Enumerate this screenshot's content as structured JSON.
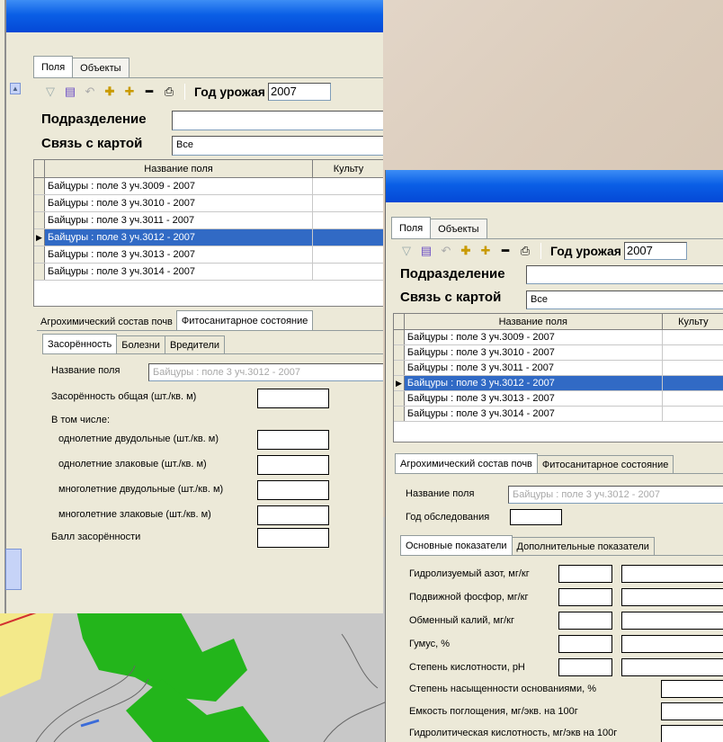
{
  "window1": {
    "tabs": [
      {
        "label": "Поля",
        "active": true
      },
      {
        "label": "Объекты",
        "active": false
      }
    ],
    "toolbar": {
      "year_label": "Год урожая",
      "year_value": "2007"
    },
    "subdivision_label": "Подразделение",
    "subdivision_value": "",
    "map_link_label": "Связь с картой",
    "map_link_value": "Все",
    "grid": {
      "columns": [
        "Название поля",
        "Культу"
      ],
      "rows": [
        "Байцуры : поле 3 уч.3009 - 2007",
        "Байцуры : поле 3 уч.3010 - 2007",
        "Байцуры : поле 3 уч.3011 - 2007",
        "Байцуры : поле 3 уч.3012 - 2007",
        "Байцуры : поле 3 уч.3013 - 2007",
        "Байцуры : поле 3 уч.3014 - 2007"
      ],
      "selected_index": 3
    },
    "section_tabs": [
      "Агрохимический состав почв",
      "Фитосанитарное состояние"
    ],
    "sub_tabs": [
      "Засорённость",
      "Болезни",
      "Вредители"
    ],
    "field_name_label": "Название поля",
    "field_name_value": "Байцуры : поле 3 уч.3012 - 2007",
    "weed_total_label": "Засорённость общая (шт./кв. м)",
    "including_label": "В том числе:",
    "weed_items": [
      "однолетние двудольные (шт./кв. м)",
      "однолетние злаковые (шт./кв. м)",
      "многолетние двудольные (шт./кв. м)",
      "многолетние злаковые (шт./кв. м)"
    ],
    "weed_score_label": "Балл засорённости"
  },
  "window2": {
    "tabs": [
      {
        "label": "Поля",
        "active": true
      },
      {
        "label": "Объекты",
        "active": false
      }
    ],
    "toolbar": {
      "year_label": "Год урожая",
      "year_value": "2007"
    },
    "subdivision_label": "Подразделение",
    "subdivision_value": "",
    "map_link_label": "Связь с картой",
    "map_link_value": "Все",
    "grid": {
      "columns": [
        "Название поля",
        "Культу"
      ],
      "rows": [
        "Байцуры : поле 3 уч.3009 - 2007",
        "Байцуры : поле 3 уч.3010 - 2007",
        "Байцуры : поле 3 уч.3011 - 2007",
        "Байцуры : поле 3 уч.3012 - 2007",
        "Байцуры : поле 3 уч.3013 - 2007",
        "Байцуры : поле 3 уч.3014 - 2007"
      ],
      "selected_index": 3
    },
    "section_tabs": [
      "Агрохимический состав почв",
      "Фитосанитарное состояние"
    ],
    "field_name_label": "Название поля",
    "field_name_value": "Байцуры : поле 3 уч.3012 - 2007",
    "survey_year_label": "Год обследования",
    "indicator_tabs": [
      "Основные показатели",
      "Дополнительные показатели"
    ],
    "indicators": [
      "Гидролизуемый азот, мг/кг",
      "Подвижной фосфор, мг/кг",
      "Обменный калий, мг/кг",
      "Гумус, %",
      "Степень кислотности, pH"
    ],
    "indicators_extra": [
      "Степень насыщенности основаниями, %",
      "Емкость поглощения, мг/экв. на 100г",
      "Гидролитическая кислотность, мг/экв на 100г"
    ]
  }
}
